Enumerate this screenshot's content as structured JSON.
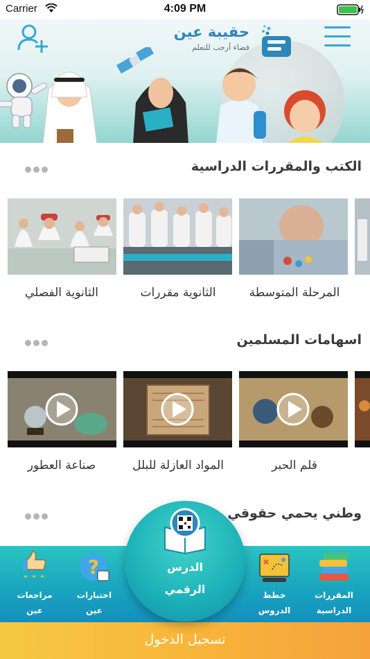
{
  "status_bar": {
    "carrier": "Carrier",
    "time": "4:09 PM"
  },
  "header": {
    "app_name": "حقيبة عين",
    "tagline": "فضاء أرحب للتعلم"
  },
  "sections": [
    {
      "title": "الكتب والمقررات الدراسية",
      "items": [
        {
          "label": "المرحلة المتوسطة"
        },
        {
          "label": "الثانوية مقررات"
        },
        {
          "label": "الثانوية الفصلي"
        }
      ]
    },
    {
      "title": "اسهامات المسلمين",
      "items": [
        {
          "label": "قلم الحبر"
        },
        {
          "label": "المواد العازلة للبلل"
        },
        {
          "label": "صناعة العطور"
        }
      ]
    },
    {
      "title": "وطني يحمي حقوقي"
    }
  ],
  "bottom_nav": {
    "courses": [
      "المقررات",
      "الدراسية"
    ],
    "lesson_plans": [
      "خطط",
      "الدروس"
    ],
    "digital_lesson": [
      "الدرس",
      "الرقمي"
    ],
    "tests": [
      "اختبارات",
      "عين"
    ],
    "reviews": [
      "مراجعات",
      "عين"
    ]
  },
  "login": {
    "label": "تسجيل الدخول"
  },
  "colors": {
    "primary": "#2d87b8",
    "nav_teal": "#19a6bf",
    "login_orange": "#f8b63a"
  }
}
